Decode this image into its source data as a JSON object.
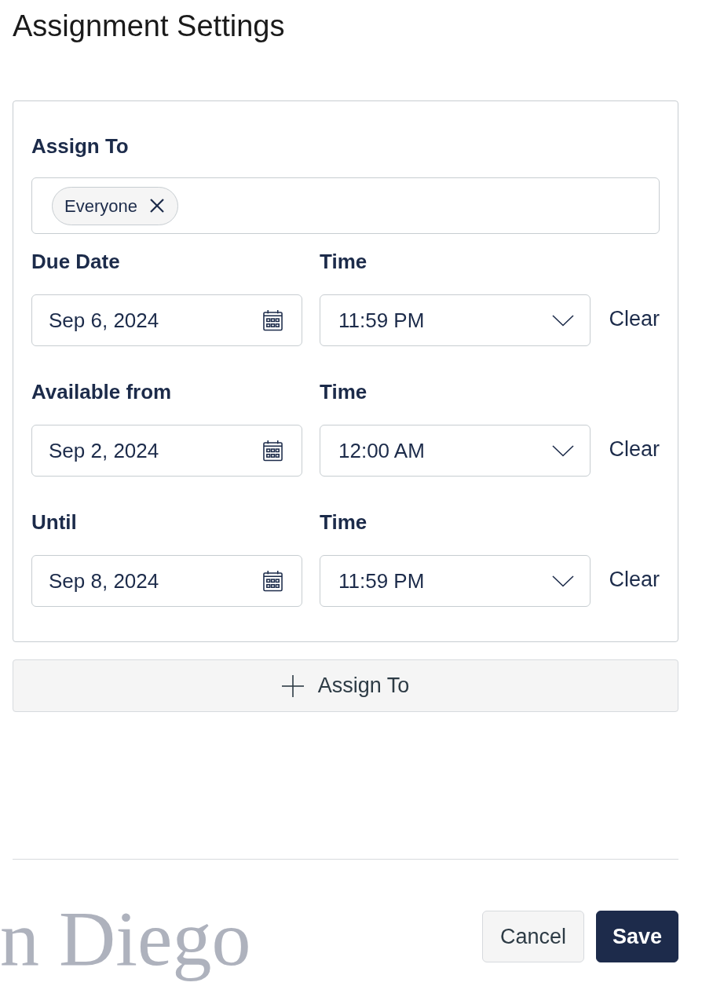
{
  "title": "Assignment Settings",
  "assign_card": {
    "assign_to": {
      "label": "Assign To",
      "chips": [
        {
          "label": "Everyone"
        }
      ]
    },
    "date_rows": [
      {
        "date_label": "Due Date",
        "date_value": "Sep 6, 2024",
        "time_label": "Time",
        "time_value": "11:59 PM",
        "clear_label": "Clear"
      },
      {
        "date_label": "Available from",
        "date_value": "Sep 2, 2024",
        "time_label": "Time",
        "time_value": "12:00 AM",
        "clear_label": "Clear"
      },
      {
        "date_label": "Until",
        "date_value": "Sep 8, 2024",
        "time_label": "Time",
        "time_value": "11:59 PM",
        "clear_label": "Clear"
      }
    ]
  },
  "add_assignee_button": {
    "label": "Assign To"
  },
  "footer": {
    "buttons": [
      {
        "label": "Cancel",
        "kind": "secondary"
      },
      {
        "label": "Save",
        "kind": "primary"
      }
    ]
  },
  "background_logo_text": "n Diego"
}
